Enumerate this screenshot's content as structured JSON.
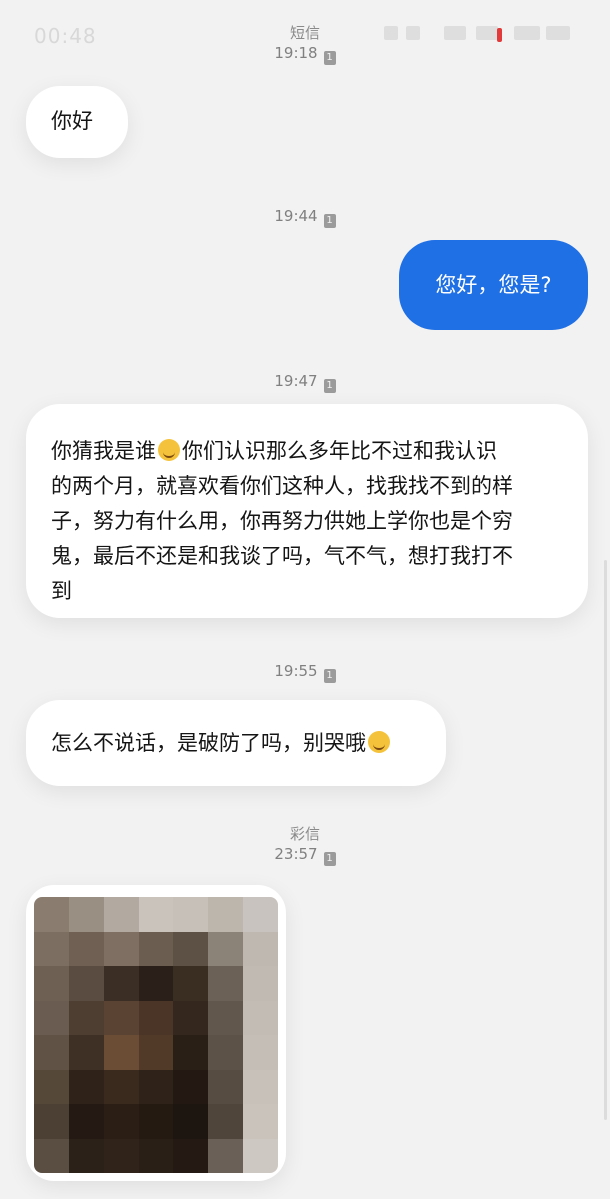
{
  "status_bar": {
    "time": "00:48"
  },
  "header": {
    "title": "短信",
    "first_time": "19:18",
    "sim": "1"
  },
  "messages": [
    {
      "direction": "in",
      "text": "你好"
    },
    {
      "time": "19:44",
      "sim": "1"
    },
    {
      "direction": "out",
      "text": "您好，您是?"
    },
    {
      "time": "19:47",
      "sim": "1"
    },
    {
      "direction": "in",
      "lines": [
        [
          "你猜我是谁",
          "你们认识那么多年比不过和我认识"
        ],
        "的两个月，就喜欢看你们这种人，找我找不到的样",
        "子，努力有什么用，你再努力供她上学你也是个穷",
        "鬼，最后不还是和我谈了吗，气不气，想打我打不",
        "到"
      ],
      "emoji": "rolling-on-floor-laughing-emoji"
    },
    {
      "time": "19:55",
      "sim": "1"
    },
    {
      "direction": "in",
      "text": "怎么不说话，是破防了吗，别哭哦",
      "emoji": "tears-of-joy-emoji"
    },
    {
      "section": "彩信",
      "time": "23:57",
      "sim": "1"
    },
    {
      "direction": "in",
      "type": "mms-image",
      "content": "pixelated photo"
    }
  ],
  "colors": {
    "background": "#f2f2f2",
    "incoming_bubble": "#ffffff",
    "outgoing_bubble": "#1f6fe5"
  }
}
